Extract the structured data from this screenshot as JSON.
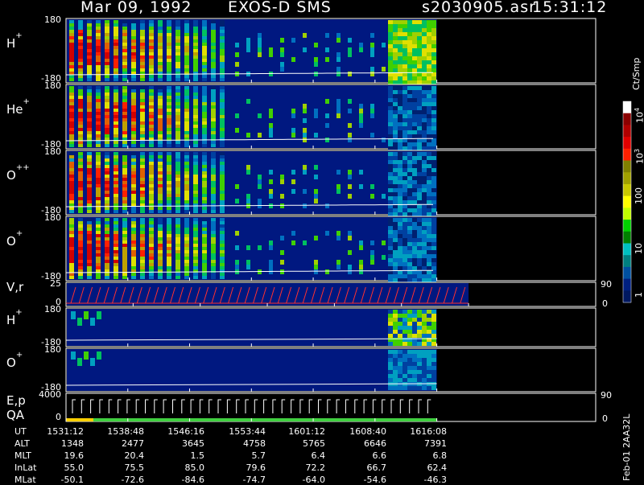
{
  "header": {
    "date": "Mar 09, 1992",
    "instrument": "EXOS-D SMS",
    "file": "s2030905.asr",
    "time": "15:31:12"
  },
  "panels": [
    {
      "name": "H",
      "sup": "+",
      "top_tick": "180",
      "bottom_tick": "-180",
      "kind": "spectrogram",
      "data_end": 0.7
    },
    {
      "name": "He",
      "sup": "+",
      "top_tick": "180",
      "bottom_tick": "-180",
      "kind": "spectrogram",
      "data_end": 0.7
    },
    {
      "name": "O",
      "sup": "++",
      "top_tick": "180",
      "bottom_tick": "-180",
      "kind": "spectrogram",
      "data_end": 0.7
    },
    {
      "name": "O",
      "sup": "+",
      "top_tick": "180",
      "bottom_tick": "-180",
      "kind": "spectrogram",
      "data_end": 0.7
    },
    {
      "name": "V,r",
      "sup": "",
      "top_tick": "25",
      "bottom_tick": "0",
      "kind": "line",
      "right_top": "90",
      "right_bottom": "0",
      "data_end": 0.76
    },
    {
      "name": "H",
      "sup": "+",
      "top_tick": "180",
      "bottom_tick": "-180",
      "kind": "spectrogram",
      "data_end": 0.7
    },
    {
      "name": "O",
      "sup": "+",
      "top_tick": "180",
      "bottom_tick": "-180",
      "kind": "spectrogram",
      "data_end": 0.7
    },
    {
      "name": "E,p",
      "sup": "",
      "name2": "QA",
      "top_tick": "4000",
      "bottom_tick": "0",
      "kind": "qa",
      "right_top": "90",
      "right_bottom": "0",
      "data_end": 0.7
    }
  ],
  "colorbar": {
    "unit": "Ct/Smp",
    "labels": [
      "10",
      "10",
      "100",
      "10",
      "1"
    ],
    "sup_labels": [
      "4",
      "3",
      "",
      "",
      ""
    ],
    "colors": [
      "#ffffff",
      "#8b0000",
      "#b00000",
      "#e00000",
      "#ff2000",
      "#808000",
      "#a0a000",
      "#c8c800",
      "#ffff00",
      "#c0ff00",
      "#00d000",
      "#008000",
      "#00c0c0",
      "#008080",
      "#0050a0",
      "#002080",
      "#001860"
    ]
  },
  "footer": {
    "row_labels": [
      "UT",
      "ALT",
      "MLT",
      "InLat",
      "MLat"
    ],
    "columns": [
      [
        "1531:12",
        "1348",
        "19.6",
        "55.0",
        "-50.1"
      ],
      [
        "1538:48",
        "2477",
        "20.4",
        "75.5",
        "-72.6"
      ],
      [
        "1546:16",
        "3645",
        "1.5",
        "85.0",
        "-84.6"
      ],
      [
        "1553:44",
        "4758",
        "5.7",
        "79.6",
        "-74.7"
      ],
      [
        "1601:12",
        "5765",
        "6.4",
        "72.2",
        "-64.0"
      ],
      [
        "1608:40",
        "6646",
        "6.6",
        "66.7",
        "-54.6"
      ],
      [
        "1616:08",
        "7391",
        "6.8",
        "62.4",
        "-46.3"
      ]
    ],
    "stamp": "Feb-01 2AA32L"
  },
  "chart_data": {
    "type": "heatmap",
    "title": "Mar 09, 1992   EXOS-D SMS",
    "x_ticks": [
      "1531:12",
      "1538:48",
      "1546:16",
      "1553:44",
      "1601:12",
      "1608:40",
      "1616:08"
    ],
    "y_range": [
      -180,
      180
    ],
    "colorbar_range": [
      1,
      10000
    ],
    "colorbar_scale": "log",
    "colorbar_unit": "Ct/Smp"
  }
}
